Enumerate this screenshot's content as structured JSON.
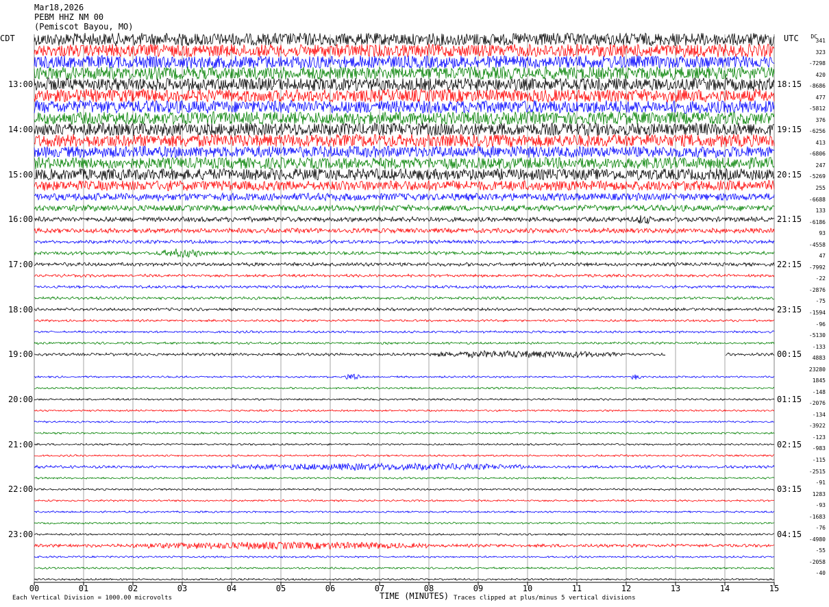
{
  "header": {
    "date": "Mar18,2026",
    "station": "PEBM HHZ NM 00",
    "location": "(Pemiscot Bayou, MO)"
  },
  "tz": {
    "left": "CDT",
    "right": "UTC",
    "dc": "DC"
  },
  "colors": {
    "trace_cycle": [
      "#000000",
      "#ff0000",
      "#0000ff",
      "#008000"
    ],
    "grid": "#808080"
  },
  "chart_data": {
    "type": "line",
    "title": "PEBM HHZ NM 00",
    "xlabel": "TIME (MINUTES)",
    "xlim": [
      0,
      15
    ],
    "x_ticks": [
      "00",
      "01",
      "02",
      "03",
      "04",
      "05",
      "06",
      "07",
      "08",
      "09",
      "10",
      "11",
      "12",
      "13",
      "14",
      "15"
    ],
    "row_count": 49,
    "minutes_per_row": 15,
    "left_hour_labels": [
      "13:00",
      "14:00",
      "15:00",
      "16:00",
      "17:00",
      "18:00",
      "19:00",
      "20:00",
      "21:00",
      "22:00",
      "23:00"
    ],
    "right_hour_labels": [
      "18:15",
      "19:15",
      "20:15",
      "21:15",
      "22:15",
      "23:15",
      "00:15",
      "01:15",
      "02:15",
      "03:15",
      "04:15"
    ],
    "dc_offsets": [
      "341",
      "323",
      "-7298",
      "420",
      "-8686",
      "477",
      "-5812",
      "376",
      "-6256",
      "413",
      "-6806",
      "247",
      "-5269",
      "255",
      "-6688",
      "133",
      "-6186",
      "93",
      "-4558",
      "47",
      "-7992",
      "-22",
      "-2876",
      "-75",
      "-1594",
      "-96",
      "-5130",
      "-133",
      "4883",
      "23280",
      "1845",
      "-148",
      "-2076",
      "-134",
      "-3922",
      "-123",
      "-983",
      "-115",
      "-2515",
      "-91",
      "1283",
      "-93",
      "-1683",
      "-76",
      "-4980",
      "-55",
      "-2058",
      "-40"
    ],
    "amplitude_levels": [
      9,
      9,
      9,
      9,
      9,
      9,
      9,
      9,
      9,
      9,
      8,
      8,
      8,
      7,
      5,
      4,
      3,
      3,
      2,
      2,
      2,
      1.5,
      1.5,
      1.5,
      1.5,
      1.2,
      1.2,
      1.2,
      1.5,
      0,
      1,
      1,
      1,
      1,
      1,
      1,
      1,
      1,
      1.5,
      1,
      1,
      1,
      1,
      1,
      1,
      1.8,
      1,
      1,
      1
    ],
    "events": [
      {
        "row": 28,
        "start_min": 8.0,
        "end_min": 11.8,
        "amp": 2.5
      },
      {
        "row": 38,
        "start_min": 4.0,
        "end_min": 10.0,
        "amp": 2.5
      },
      {
        "row": 45,
        "start_min": 2.0,
        "end_min": 8.0,
        "amp": 2.5
      },
      {
        "row": 16,
        "start_min": 12.2,
        "end_min": 12.5,
        "amp": 3
      },
      {
        "row": 19,
        "start_min": 2.5,
        "end_min": 3.5,
        "amp": 3
      },
      {
        "row": 30,
        "start_min": 6.3,
        "end_min": 6.6,
        "amp": 3
      },
      {
        "row": 30,
        "start_min": 12.1,
        "end_min": 12.3,
        "amp": 3
      }
    ],
    "gaps": [
      {
        "row": 28,
        "start_min": 12.8,
        "end_min": 14.0
      },
      {
        "row": 29,
        "start_min": 0.0,
        "end_min": 15.0
      }
    ]
  },
  "footer": {
    "left_note": "Each Vertical Division = 1000.00 microvolts",
    "right_note": "Traces clipped at plus/minus 5 vertical divisions"
  }
}
